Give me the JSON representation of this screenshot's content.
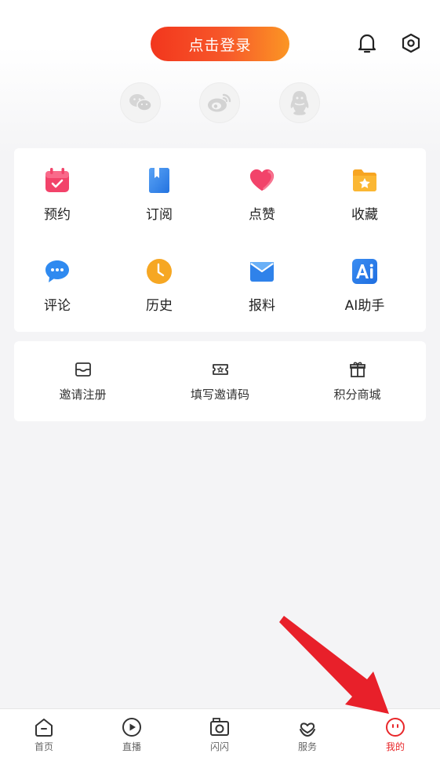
{
  "header": {
    "login_label": "点击登录",
    "bell_icon": "bell-icon",
    "settings_icon": "hexagon-settings-icon"
  },
  "social_logins": [
    {
      "name": "wechat",
      "icon": "wechat-icon"
    },
    {
      "name": "weibo",
      "icon": "weibo-icon"
    },
    {
      "name": "qq",
      "icon": "qq-icon"
    }
  ],
  "grid": {
    "items": [
      {
        "label": "预约",
        "icon": "calendar-check-icon"
      },
      {
        "label": "订阅",
        "icon": "bookmark-book-icon"
      },
      {
        "label": "点赞",
        "icon": "heart-icon"
      },
      {
        "label": "收藏",
        "icon": "star-folder-icon"
      },
      {
        "label": "评论",
        "icon": "chat-bubble-icon"
      },
      {
        "label": "历史",
        "icon": "clock-icon"
      },
      {
        "label": "报料",
        "icon": "envelope-icon"
      },
      {
        "label": "AI助手",
        "icon": "ai-icon"
      }
    ]
  },
  "invite": {
    "items": [
      {
        "label": "邀请注册",
        "icon": "inbox-icon"
      },
      {
        "label": "填写邀请码",
        "icon": "ticket-icon"
      },
      {
        "label": "积分商城",
        "icon": "gift-icon"
      }
    ]
  },
  "tabbar": {
    "items": [
      {
        "label": "首页",
        "icon": "home-icon"
      },
      {
        "label": "直播",
        "icon": "play-icon"
      },
      {
        "label": "闪闪",
        "icon": "camera-icon"
      },
      {
        "label": "服务",
        "icon": "heart-hands-icon"
      },
      {
        "label": "我的",
        "icon": "profile-face-icon",
        "active": true
      }
    ]
  },
  "colors": {
    "accent": "#e8272a",
    "login_gradient_start": "#f2361d",
    "login_gradient_end": "#fb9624",
    "annotation_arrow": "#e8202a"
  }
}
